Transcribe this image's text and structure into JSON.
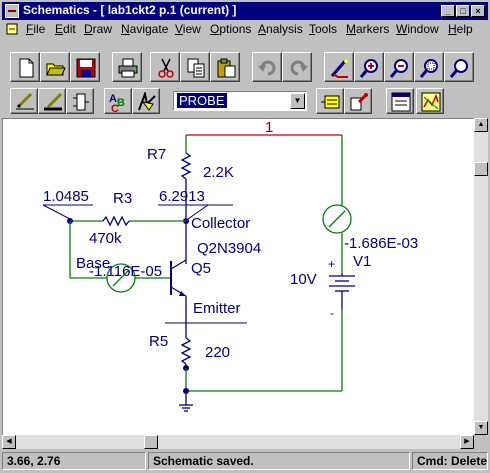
{
  "window": {
    "title": "Schematics - [ lab1ckt2  p.1 (current) ]",
    "controls": {
      "minimize": "_",
      "maximize": "□",
      "close": "×"
    }
  },
  "menubar": {
    "items": [
      {
        "label": "File",
        "key": "F",
        "rest": "ile"
      },
      {
        "label": "Edit",
        "key": "E",
        "rest": "dit"
      },
      {
        "label": "Draw",
        "key": "D",
        "rest": "raw"
      },
      {
        "label": "Navigate",
        "key": "N",
        "rest": "avigate"
      },
      {
        "label": "View",
        "key": "V",
        "rest": "iew"
      },
      {
        "label": "Options",
        "key": "O",
        "rest": "ptions"
      },
      {
        "label": "Analysis",
        "key": "A",
        "rest": "nalysis"
      },
      {
        "label": "Tools",
        "key": "T",
        "rest": "ools"
      },
      {
        "label": "Markers",
        "key": "M",
        "rest": "arkers"
      },
      {
        "label": "Window",
        "key": "W",
        "rest": "indow"
      },
      {
        "label": "Help",
        "key": "H",
        "rest": "elp"
      }
    ]
  },
  "toolbar1": {
    "buttons": [
      "new-icon",
      "open-icon",
      "save-icon",
      "print-icon",
      "cut-icon",
      "copy-icon",
      "paste-icon",
      "undo-icon",
      "redo-icon",
      "redraw-icon",
      "zoom-in-icon",
      "zoom-out-icon",
      "zoom-area-icon",
      "zoom-fit-icon"
    ]
  },
  "toolbar2": {
    "buttons": [
      "draw-wire-icon",
      "draw-bus-icon",
      "draw-block-icon",
      "spell-check-icon",
      "get-part-icon",
      "edit-attributes-icon",
      "setup-probe-icon",
      "simulate-icon",
      "probe-icon"
    ],
    "probe_select_value": "PROBE"
  },
  "schematic": {
    "node_label": "1",
    "r7_name": "R7",
    "r7_value": "2.2K",
    "collector_voltage": "6.2913",
    "base_voltage": "1.0485",
    "r3_name": "R3",
    "r3_value": "470k",
    "collector_label": "Collector",
    "transistor_model": "Q2N3904",
    "base_label": "Base",
    "base_current": "-1.116E-05",
    "transistor_name": "Q5",
    "source_current": "-1.686E-03",
    "source_name": "V1",
    "source_value": "10V",
    "plus_sign": "+",
    "minus_sign": "-",
    "emitter_label": "Emitter",
    "r5_name": "R5",
    "r5_value": "220"
  },
  "statusbar": {
    "coords": "3.66,  2.76",
    "message": "Schematic saved.",
    "command": "Cmd: Delete"
  },
  "colors": {
    "wire": "#008000",
    "part": "#000080",
    "selected_wire": "#c00000",
    "title_bar": "#000080"
  }
}
